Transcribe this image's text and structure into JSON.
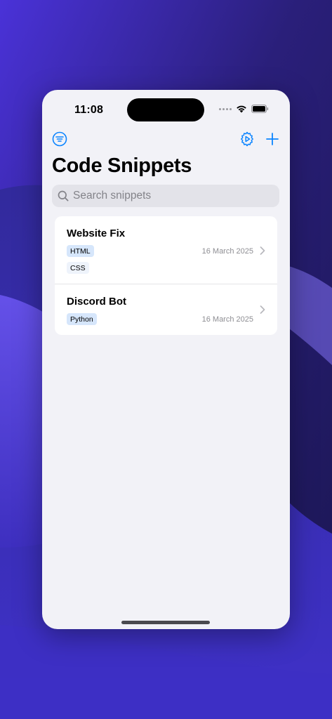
{
  "status_bar": {
    "time": "11:08"
  },
  "toolbar": {
    "filter_icon": "filter-circle-icon",
    "settings_icon": "gear-play-icon",
    "add_icon": "plus-icon",
    "accent_color": "#0a84ff"
  },
  "page": {
    "title": "Code Snippets"
  },
  "search": {
    "placeholder": "Search snippets",
    "value": ""
  },
  "snippets": [
    {
      "title": "Website Fix",
      "tags": [
        "HTML",
        "CSS"
      ],
      "date": "16 March 2025"
    },
    {
      "title": "Discord Bot",
      "tags": [
        "Python"
      ],
      "date": "16 March 2025"
    }
  ]
}
